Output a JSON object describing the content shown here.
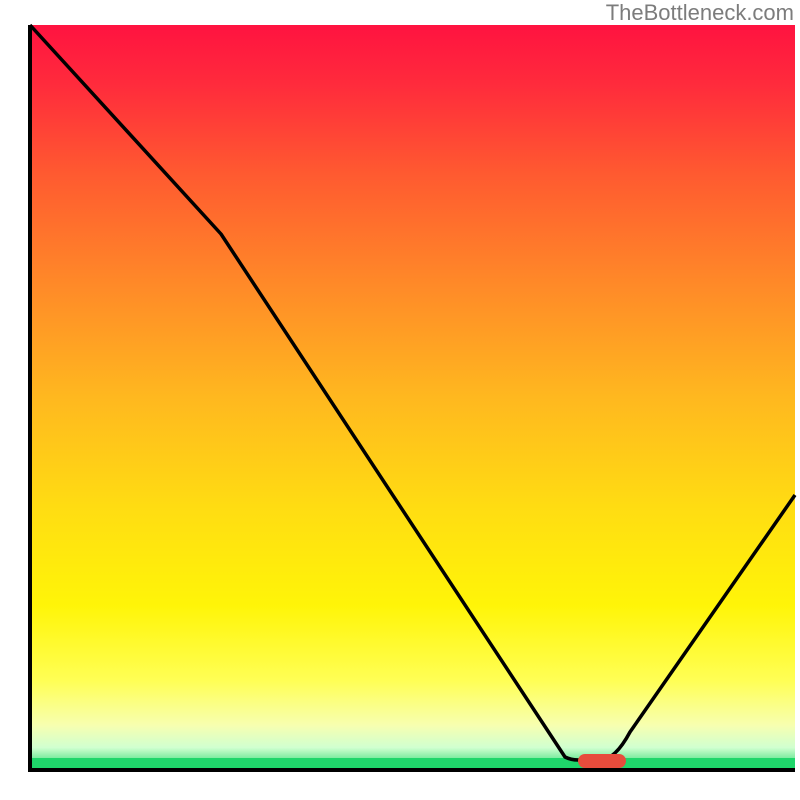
{
  "attribution": "TheBottleneck.com",
  "chart_data": {
    "type": "line",
    "title": "",
    "xlabel": "",
    "ylabel": "",
    "xlim": [
      0,
      100
    ],
    "ylim": [
      0,
      100
    ],
    "grid": false,
    "series": [
      {
        "name": "bottleneck-curve",
        "x": [
          0,
          25,
          70,
          74.5,
          78,
          100
        ],
        "values": [
          100,
          72,
          1.5,
          1.5,
          1.5,
          37
        ]
      }
    ],
    "marker": {
      "name": "marker-optimal",
      "x_start": 74,
      "x_end": 79,
      "y": 1.5,
      "color": "#e74c3c"
    },
    "background_gradient": {
      "top_color": "#ff133f",
      "mid_colors": [
        "#ff7a28",
        "#ffe500",
        "#ffff66"
      ],
      "bottom_band_color": "#1fd66a"
    },
    "axes_color": "#000000"
  }
}
